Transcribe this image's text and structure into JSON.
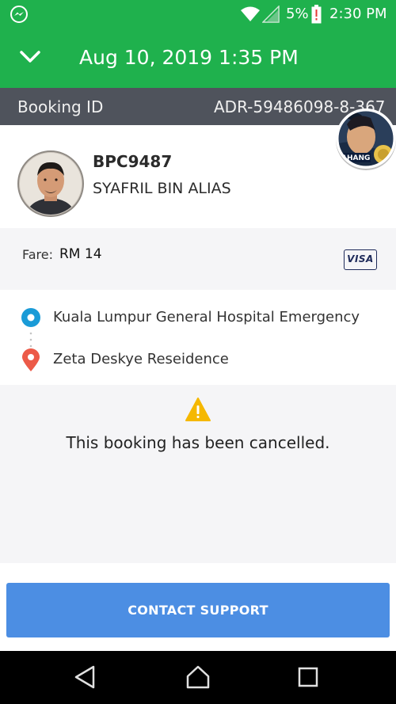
{
  "status_bar": {
    "battery_percent": "5%",
    "time": "2:30 PM"
  },
  "header": {
    "date_time": "Aug 10, 2019 1:35 PM"
  },
  "booking": {
    "id_label": "Booking ID",
    "id_value": "ADR-59486098-8-367"
  },
  "driver": {
    "plate": "BPC9487",
    "name": "SYAFRIL BIN ALIAS"
  },
  "floating_bubble": {
    "badge_text": "AHANG"
  },
  "fare": {
    "label": "Fare:",
    "value": "RM 14",
    "payment_method": "VISA"
  },
  "route": {
    "pickup": "Kuala Lumpur General Hospital Emergency",
    "dropoff": "Zeta Deskye Reseidence"
  },
  "notice": {
    "message": "This booking has been cancelled."
  },
  "actions": {
    "contact_support": "CONTACT SUPPORT"
  },
  "colors": {
    "primary_green": "#1fb14d",
    "id_bar": "#4f535c",
    "button_blue": "#4c8ee3",
    "pickup_blue": "#1a9bd7",
    "dropoff_red": "#ec5a48",
    "warning_yellow": "#f5b800"
  },
  "icons": [
    "messenger-icon",
    "wifi-icon",
    "cell-signal-icon",
    "battery-icon",
    "chevron-down-icon",
    "pickup-pin-icon",
    "dropoff-pin-icon",
    "warning-icon",
    "nav-back-icon",
    "nav-home-icon",
    "nav-recents-icon"
  ]
}
